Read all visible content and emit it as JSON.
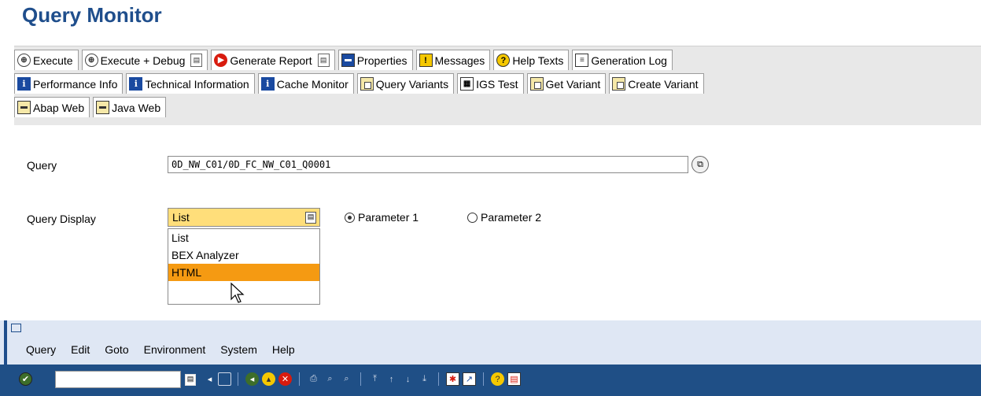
{
  "window": {
    "title": "Query Monitor"
  },
  "toolbar": {
    "row1": [
      {
        "id": "execute",
        "label": "Execute",
        "icon": "execute-icon"
      },
      {
        "id": "execute-debug",
        "label": "Execute + Debug",
        "icon": "execute-icon",
        "menu": true
      },
      {
        "id": "generate-report",
        "label": "Generate Report",
        "icon": "generate-icon",
        "menu": true
      },
      {
        "id": "properties",
        "label": "Properties",
        "icon": "properties-icon"
      },
      {
        "id": "messages",
        "label": "Messages",
        "icon": "messages-icon"
      },
      {
        "id": "help-texts",
        "label": "Help Texts",
        "icon": "help-icon"
      },
      {
        "id": "generation-log",
        "label": "Generation Log",
        "icon": "log-icon"
      }
    ],
    "row2": [
      {
        "id": "performance-info",
        "label": "Performance Info",
        "icon": "info-icon"
      },
      {
        "id": "technical-information",
        "label": "Technical Information",
        "icon": "info-icon"
      },
      {
        "id": "cache-monitor",
        "label": "Cache Monitor",
        "icon": "info-icon"
      },
      {
        "id": "query-variants",
        "label": "Query Variants",
        "icon": "variant-icon"
      },
      {
        "id": "igs-test",
        "label": "IGS Test",
        "icon": "igs-icon"
      },
      {
        "id": "get-variant",
        "label": "Get Variant",
        "icon": "variant-icon"
      },
      {
        "id": "create-variant",
        "label": "Create Variant",
        "icon": "variant-icon"
      }
    ],
    "row3": [
      {
        "id": "abap-web",
        "label": "Abap Web",
        "icon": "web-icon"
      },
      {
        "id": "java-web",
        "label": "Java Web",
        "icon": "web-icon"
      }
    ]
  },
  "form": {
    "query_label": "Query",
    "query_value": "0D_NW_C01/0D_FC_NW_C01_Q0001",
    "display_label": "Query Display",
    "display_selected": "List",
    "radio1_label": "Parameter 1",
    "radio2_label": "Parameter 2",
    "radio_selected": "Parameter 1",
    "options": [
      "List",
      "BEX Analyzer",
      "HTML"
    ],
    "highlighted_option": "HTML"
  },
  "menubar": {
    "items": [
      "Query",
      "Edit",
      "Goto",
      "Environment",
      "System",
      "Help"
    ]
  },
  "colors": {
    "title": "#1f4e8c",
    "toolbar_bg": "#e8e8e8",
    "dropdown_selected_bg": "#ffde7a",
    "highlight_option": "#f59a12",
    "menubar_bg": "#dfe7f4",
    "std_toolbar_bg": "#1f4f86"
  }
}
